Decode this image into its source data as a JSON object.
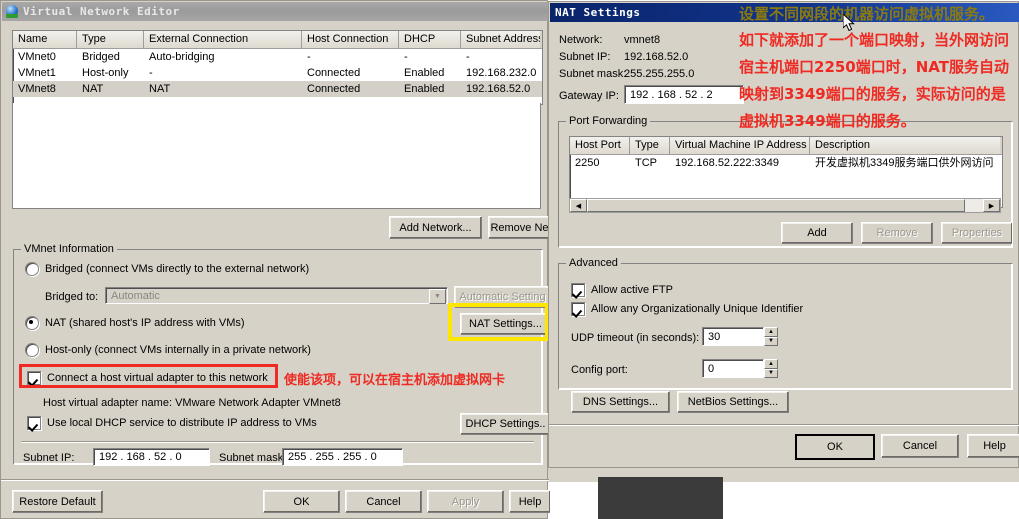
{
  "editor_window": {
    "title": "Virtual Network Editor",
    "table": {
      "columns": [
        "Name",
        "Type",
        "External Connection",
        "Host Connection",
        "DHCP",
        "Subnet Address"
      ],
      "rows": [
        {
          "name": "VMnet0",
          "type": "Bridged",
          "external": "Auto-bridging",
          "host": "-",
          "dhcp": "-",
          "subnet": "-",
          "selected": false
        },
        {
          "name": "VMnet1",
          "type": "Host-only",
          "external": "-",
          "host": "Connected",
          "dhcp": "Enabled",
          "subnet": "192.168.232.0",
          "selected": false
        },
        {
          "name": "VMnet8",
          "type": "NAT",
          "external": "NAT",
          "host": "Connected",
          "dhcp": "Enabled",
          "subnet": "192.168.52.0",
          "selected": true
        }
      ]
    },
    "add_network_label": "Add Network...",
    "remove_network_label": "Remove Ne",
    "vmnet_info": {
      "group_title": "VMnet Information",
      "bridged_label": "Bridged (connect VMs directly to the external network)",
      "bridged_selected": false,
      "bridged_to_label": "Bridged to:",
      "bridged_to_value": "Automatic",
      "automatic_setting_label": "Automatic Setting",
      "nat_label": "NAT (shared host's IP address with VMs)",
      "nat_selected": true,
      "nat_settings_label": "NAT Settings...",
      "hostonly_label": "Host-only (connect VMs internally in a private network)",
      "hostonly_selected": false,
      "connect_adapter_label": "Connect a host virtual adapter to this network",
      "connect_adapter_checked": true,
      "adapter_name_label": "Host virtual adapter name: VMware Network Adapter VMnet8",
      "dhcp_service_label": "Use local DHCP service to distribute IP address to VMs",
      "dhcp_service_checked": true,
      "dhcp_settings_label": "DHCP Settings..",
      "subnet_ip_label": "Subnet IP:",
      "subnet_ip_value": "192 . 168 . 52 .  0",
      "subnet_mask_label": "Subnet mask:",
      "subnet_mask_value": "255 . 255 . 255 .  0"
    },
    "footer": {
      "restore_default_label": "Restore Default",
      "ok_label": "OK",
      "cancel_label": "Cancel",
      "apply_label": "Apply",
      "help_label": "Help"
    }
  },
  "nat_window": {
    "title": "NAT Settings",
    "network_label": "Network:",
    "network_value": "vmnet8",
    "subnet_ip_label": "Subnet IP:",
    "subnet_ip_value": "192.168.52.0",
    "subnet_mask_label": "Subnet mask:",
    "subnet_mask_value": "255.255.255.0",
    "gateway_ip_label": "Gateway IP:",
    "gateway_ip_value": "192 . 168 . 52 .  2",
    "port_forwarding": {
      "group_title": "Port Forwarding",
      "columns": [
        "Host Port",
        "Type",
        "Virtual Machine IP Address",
        "Description"
      ],
      "rows": [
        {
          "host_port": "2250",
          "type": "TCP",
          "vm_ip": "192.168.52.222:3349",
          "description": "开发虚拟机3349服务端口供外网访问"
        }
      ],
      "add_label": "Add",
      "remove_label": "Remove",
      "properties_label": "Properties"
    },
    "advanced": {
      "group_title": "Advanced",
      "allow_ftp_label": "Allow active FTP",
      "allow_ftp_checked": true,
      "allow_oui_label": "Allow any Organizationally Unique Identifier",
      "allow_oui_checked": true,
      "udp_timeout_label": "UDP timeout (in seconds):",
      "udp_timeout_value": "30",
      "config_port_label": "Config port:",
      "config_port_value": "0"
    },
    "dns_settings_label": "DNS Settings...",
    "netbios_settings_label": "NetBios Settings...",
    "footer": {
      "ok_label": "OK",
      "cancel_label": "Cancel",
      "help_label": "Help"
    }
  },
  "annotations": {
    "olive_line": "设置不同网段的机器访问虚拟机服务。",
    "red_lines": [
      "如下就添加了一个端口映射，当外网访问",
      "宿主机端口2250端口时，NAT服务自动",
      "映射到3349端口的服务，实际访问的是",
      "虚拟机3349端口的服务。"
    ],
    "left_note": "使能该项，可以在宿主机添加虚拟网卡"
  },
  "colors": {
    "annotation_red": "#ee2a22",
    "annotation_olive": "#8a7a10",
    "highlight_yellow": "#ffe600",
    "title_active": "#0a246a",
    "dialog_face": "#d6d2c8"
  }
}
